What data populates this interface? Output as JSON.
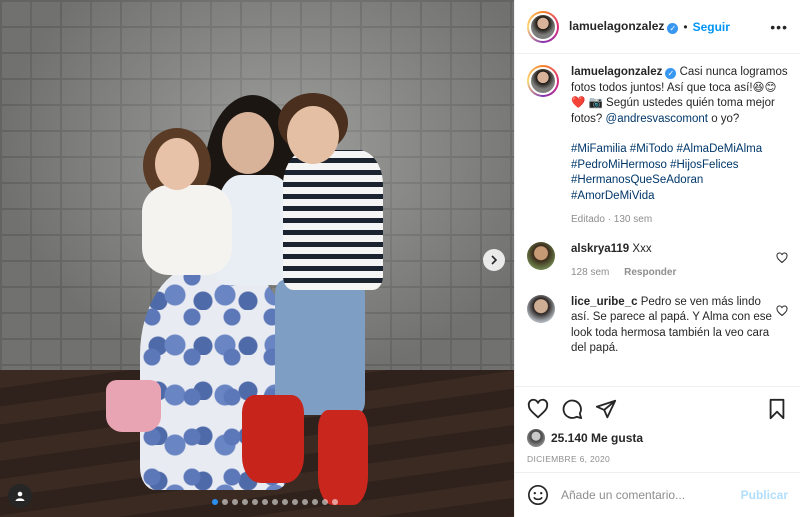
{
  "post": {
    "username": "lamuelagonzalez",
    "verified_mark": "✓",
    "separator": "•",
    "follow_label": "Seguir",
    "more_label": "•••"
  },
  "caption": {
    "username": "lamuelagonzalez",
    "text": "Casi nunca logramos fotos todos juntos! Así que toca así!😆😊❤️ 📷 Según ustedes quién toma mejor fotos?",
    "mention": "@andresvascomont",
    "text_end": "o yo?",
    "hashtags": [
      "#MiFamilia",
      "#MiTodo",
      "#AlmaDeMiAlma",
      "#PedroMiHermoso",
      "#HijosFelices",
      "#HermanosQueSeAdoran",
      "#AmorDeMiVida"
    ],
    "edited": "Editado · 130 sem"
  },
  "comments": [
    {
      "username": "alskrya119",
      "text": "Xxx",
      "age": "128 sem",
      "reply_label": "Responder"
    },
    {
      "username": "lice_uribe_c",
      "text": "Pedro se ven más lindo así. Se parece al papá. Y Alma con ese look toda hermosa también la veo cara del papá."
    }
  ],
  "likes": {
    "count": "25.140 Me gusta",
    "date": "DICIEMBRE 6, 2020"
  },
  "composer": {
    "placeholder": "Añade un comentario...",
    "publish_label": "Publicar"
  },
  "carousel": {
    "total": 13,
    "active_index": 0
  },
  "colors": {
    "accent": "#0095f6",
    "heart": "#ed4956"
  }
}
